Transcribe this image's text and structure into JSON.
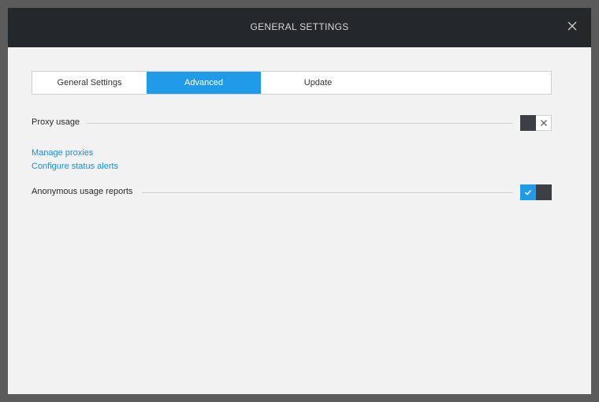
{
  "window": {
    "title": "GENERAL SETTINGS"
  },
  "tabs": [
    {
      "label": "General Settings",
      "active": false
    },
    {
      "label": "Advanced",
      "active": true
    },
    {
      "label": "Update",
      "active": false
    }
  ],
  "settings": {
    "proxy_usage": {
      "label": "Proxy usage",
      "enabled": false
    },
    "anonymous_reports": {
      "label": "Anonymous usage reports",
      "enabled": true
    }
  },
  "links": {
    "manage_proxies": "Manage proxies",
    "configure_alerts": "Configure status alerts"
  },
  "icons": {
    "close": "close-icon",
    "toggle_off": "x-icon",
    "toggle_on": "check-icon"
  },
  "colors": {
    "accent": "#1f9bea",
    "titlebar": "#25282b",
    "link": "#1a8fd6"
  }
}
